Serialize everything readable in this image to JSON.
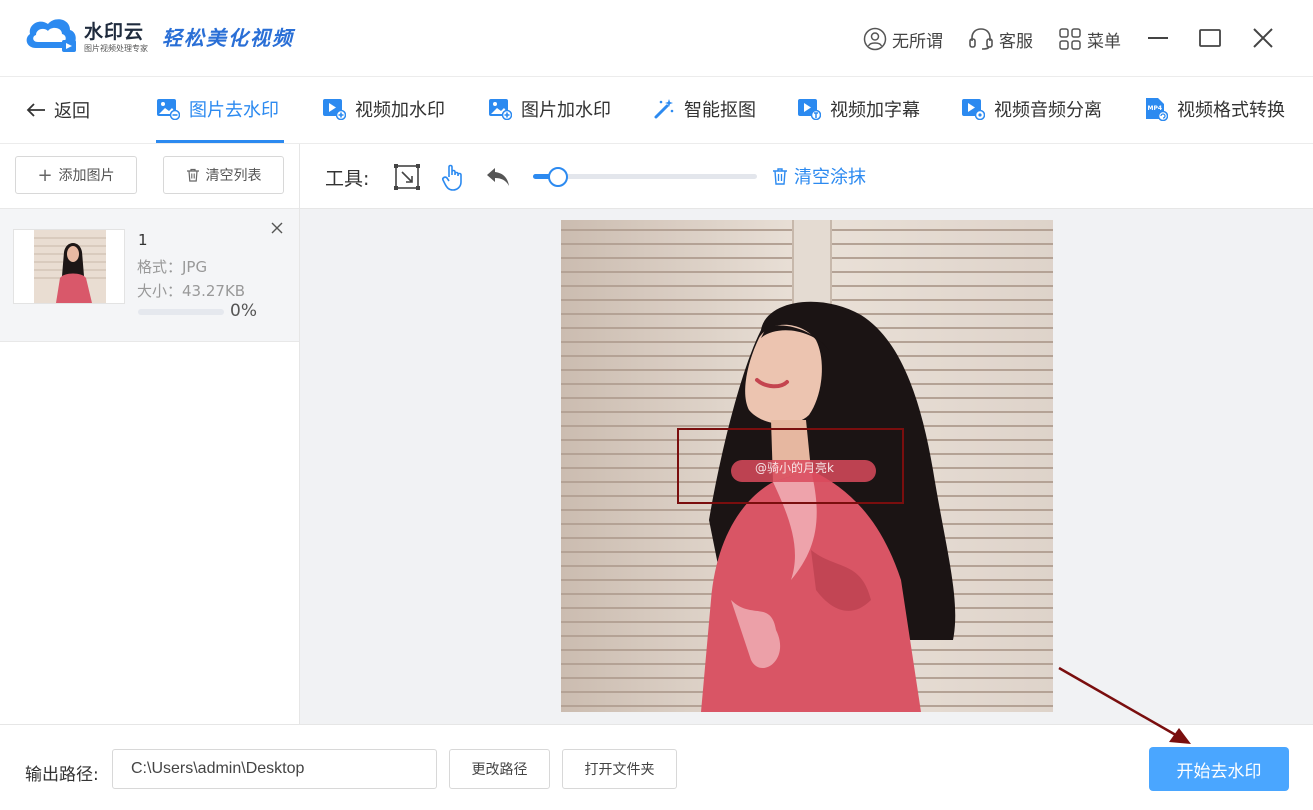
{
  "app": {
    "brand_name": "水印云",
    "brand_sub": "图片视频处理专家",
    "slogan": "轻松美化视频",
    "user_name": "无所谓",
    "service_label": "客服",
    "menu_label": "菜单"
  },
  "nav": {
    "back_label": "返回",
    "tabs": [
      {
        "label": "图片去水印",
        "icon": "image-remove-icon",
        "active": true
      },
      {
        "label": "视频加水印",
        "icon": "video-add-icon"
      },
      {
        "label": "图片加水印",
        "icon": "image-add-icon"
      },
      {
        "label": "智能抠图",
        "icon": "magic-wand-icon"
      },
      {
        "label": "视频加字幕",
        "icon": "video-subtitle-icon"
      },
      {
        "label": "视频音频分离",
        "icon": "video-audio-split-icon"
      },
      {
        "label": "视频格式转换",
        "icon": "mp4-convert-icon"
      }
    ]
  },
  "sidebar": {
    "add_label": "添加图片",
    "clear_label": "清空列表",
    "files": [
      {
        "name": "1",
        "format_label": "格式：JPG",
        "size_label": "大小：43.27KB",
        "progress": "0%",
        "progress_value": 0
      }
    ]
  },
  "toolbar": {
    "tools_label": "工具:",
    "clear_paint_label": "清空涂抹",
    "brush_size_fraction": 0.11
  },
  "canvas": {
    "watermark_text": "@骑小的月亮k"
  },
  "footer": {
    "output_label": "输出路径:",
    "output_path": "C:\\Users\\admin\\Desktop",
    "change_path_label": "更改路径",
    "open_folder_label": "打开文件夹",
    "start_label": "开始去水印"
  },
  "colors": {
    "accent": "#2c8af0",
    "start_button": "#4aa6ff",
    "mark_box": "#7a0e0e"
  }
}
